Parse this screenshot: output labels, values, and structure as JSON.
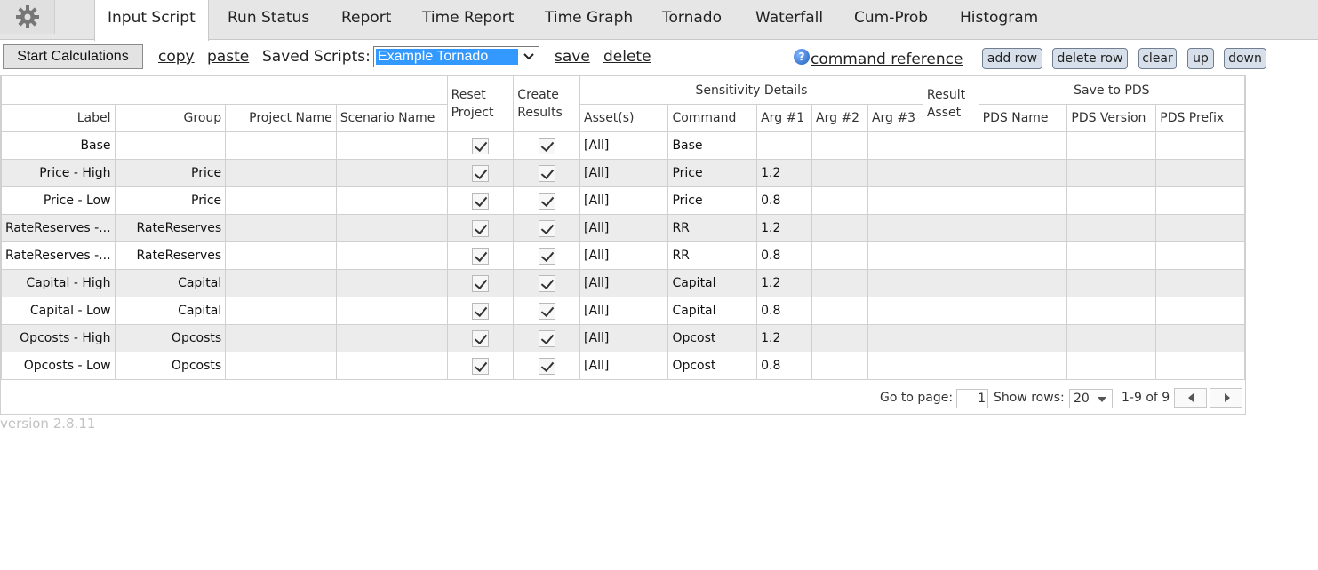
{
  "tabs": [
    "Input Script",
    "Run Status",
    "Report",
    "Time Report",
    "Time Graph",
    "Tornado",
    "Waterfall",
    "Cum-Prob",
    "Histogram"
  ],
  "toolbar": {
    "start_label": "Start Calculations",
    "copy_label": "copy",
    "paste_label": "paste",
    "saved_scripts_label": "Saved Scripts:",
    "saved_script_value": "Example Tornado",
    "save_label": "save",
    "delete_label": "delete",
    "command_reference_label": "command reference",
    "add_row_label": "add row",
    "delete_row_label": "delete row",
    "clear_label": "clear",
    "up_label": "up",
    "down_label": "down"
  },
  "grid": {
    "group_headers": {
      "reset_project": "Reset Project",
      "create_results": "Create Results",
      "sensitivity_details": "Sensitivity Details",
      "result_asset": "Result Asset",
      "save_to_pds": "Save to PDS"
    },
    "columns": {
      "label": "Label",
      "group": "Group",
      "project_name": "Project Name",
      "scenario_name": "Scenario Name",
      "assets": "Asset(s)",
      "command": "Command",
      "arg1": "Arg #1",
      "arg2": "Arg #2",
      "arg3": "Arg #3",
      "pds_name": "PDS Name",
      "pds_version": "PDS Version",
      "pds_prefix": "PDS Prefix"
    },
    "rows": [
      {
        "label": "Base",
        "group": "",
        "project": "",
        "scenario": "",
        "reset": true,
        "create": true,
        "assets": "[All]",
        "command": "Base",
        "arg1": "",
        "arg2": "",
        "arg3": ""
      },
      {
        "label": "Price - High",
        "group": "Price",
        "project": "",
        "scenario": "",
        "reset": true,
        "create": true,
        "assets": "[All]",
        "command": "Price",
        "arg1": "1.2",
        "arg2": "",
        "arg3": ""
      },
      {
        "label": "Price - Low",
        "group": "Price",
        "project": "",
        "scenario": "",
        "reset": true,
        "create": true,
        "assets": "[All]",
        "command": "Price",
        "arg1": "0.8",
        "arg2": "",
        "arg3": ""
      },
      {
        "label": "RateReserves -...",
        "group": "RateReserves",
        "project": "",
        "scenario": "",
        "reset": true,
        "create": true,
        "assets": "[All]",
        "command": "RR",
        "arg1": "1.2",
        "arg2": "",
        "arg3": ""
      },
      {
        "label": "RateReserves -...",
        "group": "RateReserves",
        "project": "",
        "scenario": "",
        "reset": true,
        "create": true,
        "assets": "[All]",
        "command": "RR",
        "arg1": "0.8",
        "arg2": "",
        "arg3": ""
      },
      {
        "label": "Capital - High",
        "group": "Capital",
        "project": "",
        "scenario": "",
        "reset": true,
        "create": true,
        "assets": "[All]",
        "command": "Capital",
        "arg1": "1.2",
        "arg2": "",
        "arg3": ""
      },
      {
        "label": "Capital - Low",
        "group": "Capital",
        "project": "",
        "scenario": "",
        "reset": true,
        "create": true,
        "assets": "[All]",
        "command": "Capital",
        "arg1": "0.8",
        "arg2": "",
        "arg3": ""
      },
      {
        "label": "Opcosts - High",
        "group": "Opcosts",
        "project": "",
        "scenario": "",
        "reset": true,
        "create": true,
        "assets": "[All]",
        "command": "Opcost",
        "arg1": "1.2",
        "arg2": "",
        "arg3": ""
      },
      {
        "label": "Opcosts - Low",
        "group": "Opcosts",
        "project": "",
        "scenario": "",
        "reset": true,
        "create": true,
        "assets": "[All]",
        "command": "Opcost",
        "arg1": "0.8",
        "arg2": "",
        "arg3": ""
      }
    ]
  },
  "pager": {
    "go_to_page_label": "Go to page:",
    "page_value": "1",
    "show_rows_label": "Show rows:",
    "rows_value": "20",
    "range_text": "1-9 of 9"
  },
  "version": "version 2.8.11",
  "colors": {
    "tabbar_bg": "#e6e6e6",
    "alt_row_bg": "#ececec",
    "select_highlight": "#3399ff",
    "pill_bg": "#d7e0ea"
  },
  "icons": [
    "gear-icon",
    "help-icon",
    "dropdown-arrow-icon",
    "checkmark-icon",
    "prev-page-icon",
    "next-page-icon"
  ]
}
